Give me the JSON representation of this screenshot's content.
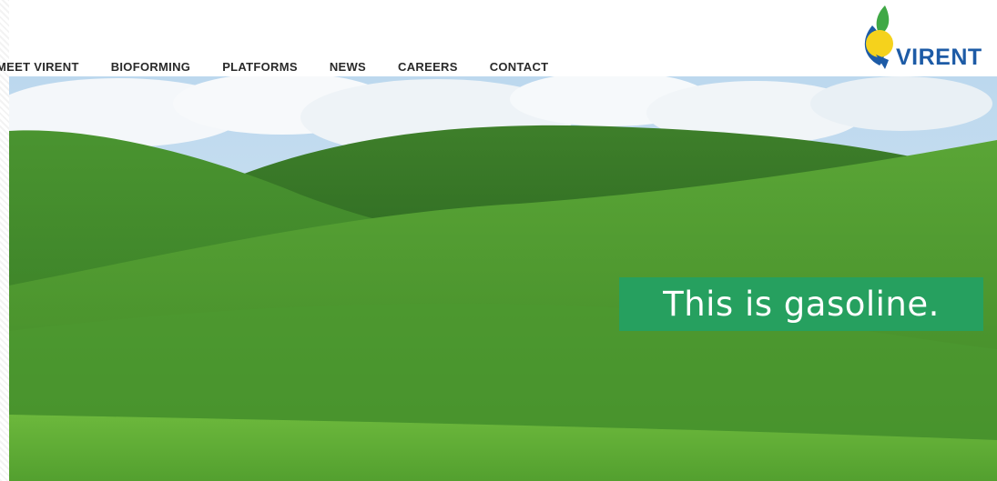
{
  "nav": {
    "items": [
      {
        "label": "MEET VIRENT"
      },
      {
        "label": "BIOFORMING"
      },
      {
        "label": "PLATFORMS"
      },
      {
        "label": "NEWS"
      },
      {
        "label": "CAREERS"
      },
      {
        "label": "CONTACT"
      }
    ]
  },
  "logo": {
    "wordmark": "VIRENT",
    "colors": {
      "blue": "#1d5ba6",
      "green": "#3fa845",
      "yellow": "#f5d21c"
    }
  },
  "hero": {
    "image_description_icon": "rolling-green-hills-photo",
    "tagline": "This is gasoline.",
    "tagline_bg": "#26a05f"
  }
}
